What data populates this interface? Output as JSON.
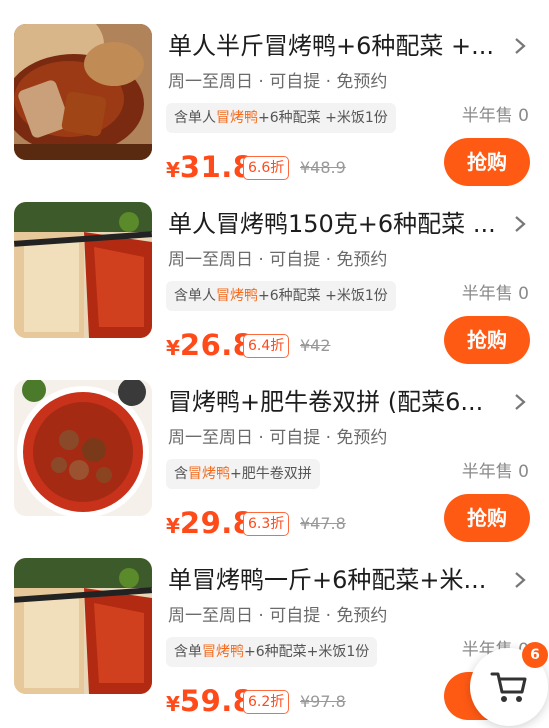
{
  "products": [
    {
      "title": "单人半斤冒烤鸭+6种配菜 +...",
      "sub": "周一至周日 · 可自提 · 免预约",
      "tag_pre": "含单人",
      "tag_hl": "冒烤鸭",
      "tag_post": "+6种配菜 +米饭1份",
      "sold": "半年售 0",
      "currency": "¥",
      "price": "31.8",
      "discount": "6.6折",
      "original": "¥48.9",
      "buy_label": "抢购",
      "image_icon": "roast-duck-photo"
    },
    {
      "title": "单人冒烤鸭150克+6种配菜 ...",
      "sub": "周一至周日 · 可自提 · 免预约",
      "tag_pre": "含单人",
      "tag_hl": "冒烤鸭",
      "tag_post": "+6种配菜 +米饭1份",
      "sold": "半年售 0",
      "currency": "¥",
      "price": "26.8",
      "discount": "6.4折",
      "original": "¥42",
      "buy_label": "抢购",
      "image_icon": "roast-duck-photo"
    },
    {
      "title": "冒烤鸭+肥牛卷双拼 (配菜6...",
      "sub": "周一至周日 · 可自提 · 免预约",
      "tag_pre": "含",
      "tag_hl": "冒烤鸭",
      "tag_post": "+肥牛卷双拼",
      "sold": "半年售 0",
      "currency": "¥",
      "price": "29.8",
      "discount": "6.3折",
      "original": "¥47.8",
      "buy_label": "抢购",
      "image_icon": "beef-hotpot-photo"
    },
    {
      "title": "单冒烤鸭一斤+6种配菜+米...",
      "sub": "周一至周日 · 可自提 · 免预约",
      "tag_pre": "含单",
      "tag_hl": "冒烤鸭",
      "tag_post": "+6种配菜+米饭1份",
      "sold": "半年售 0",
      "currency": "¥",
      "price": "59.8",
      "discount": "6.2折",
      "original": "¥97.8",
      "buy_label": "抢",
      "image_icon": "roast-duck-photo"
    }
  ],
  "cart": {
    "badge": "6",
    "icon": "shopping-cart-icon"
  },
  "colors": {
    "accent": "#ff5a14",
    "price": "#ff4a1a",
    "highlight": "#f36a1e"
  }
}
